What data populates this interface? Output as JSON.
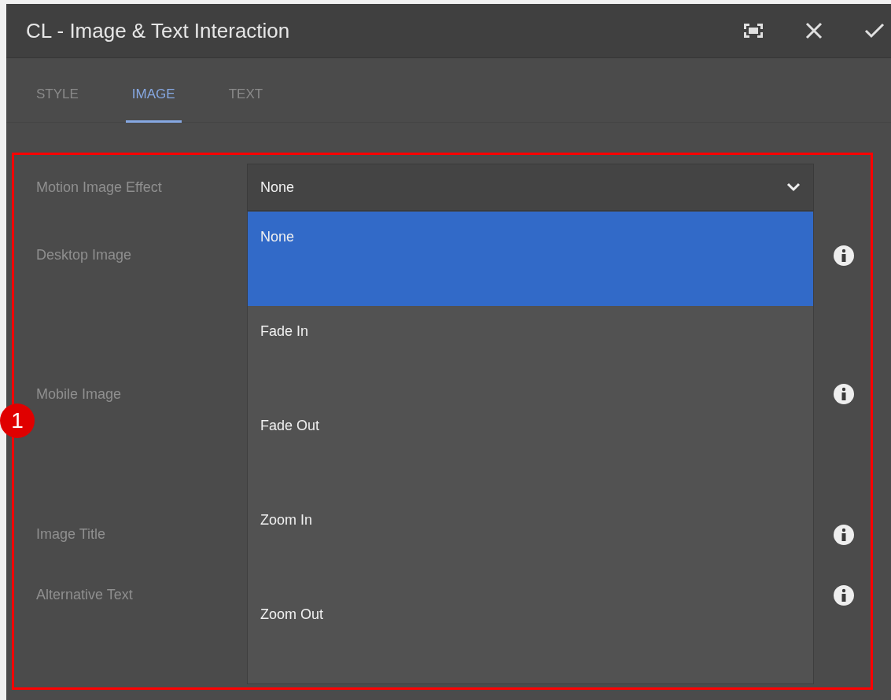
{
  "window": {
    "title": "CL - Image & Text Interaction"
  },
  "tabs": [
    {
      "label": "STYLE",
      "selected": false
    },
    {
      "label": "IMAGE",
      "selected": true
    },
    {
      "label": "TEXT",
      "selected": false
    }
  ],
  "fields": [
    {
      "label": "Motion Image Effect",
      "kind": "select",
      "value": "None",
      "info": false
    },
    {
      "label": "Desktop Image",
      "kind": "image",
      "info": true
    },
    {
      "label": "Mobile Image",
      "kind": "image",
      "info": true
    },
    {
      "label": "Image Title",
      "kind": "text",
      "info": true
    },
    {
      "label": "Alternative Text",
      "kind": "text",
      "info": true
    }
  ],
  "dropdown": {
    "options": [
      {
        "label": "None",
        "selected": true
      },
      {
        "label": "Fade In",
        "selected": false
      },
      {
        "label": "Fade Out",
        "selected": false
      },
      {
        "label": "Zoom In",
        "selected": false
      },
      {
        "label": "Zoom Out",
        "selected": false
      }
    ]
  },
  "annotation": {
    "number": "1"
  }
}
